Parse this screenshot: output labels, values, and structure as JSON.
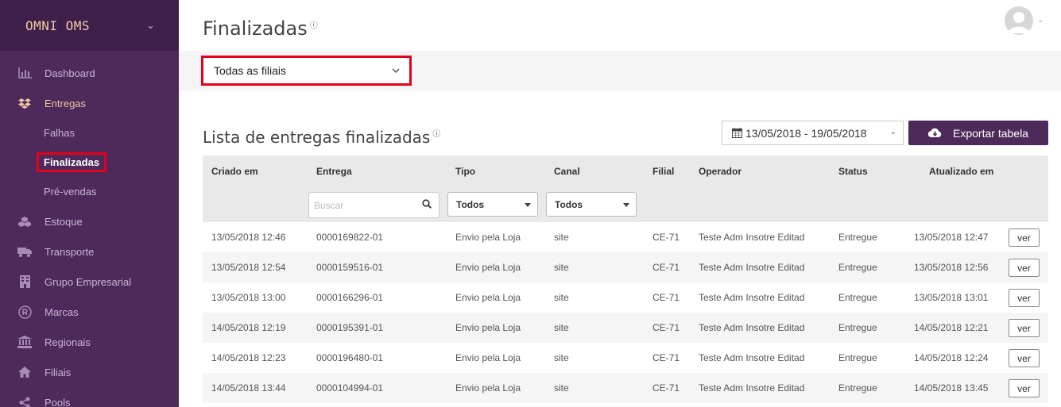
{
  "sidebar": {
    "brand": "OMNI OMS",
    "items": [
      {
        "label": "Dashboard",
        "icon": "bar-chart-icon"
      },
      {
        "label": "Entregas",
        "icon": "dropbox-icon"
      },
      {
        "label": "Falhas"
      },
      {
        "label": "Finalizadas"
      },
      {
        "label": "Pré-vendas"
      },
      {
        "label": "Estoque",
        "icon": "cubes-icon"
      },
      {
        "label": "Transporte",
        "icon": "truck-icon"
      },
      {
        "label": "Grupo Empresarial",
        "icon": "building-icon"
      },
      {
        "label": "Marcas",
        "icon": "registered-icon"
      },
      {
        "label": "Regionais",
        "icon": "bank-icon"
      },
      {
        "label": "Filiais",
        "icon": "home-icon"
      },
      {
        "label": "Pools",
        "icon": "share-icon"
      }
    ]
  },
  "header": {
    "title": "Finalizadas"
  },
  "filter": {
    "filial": "Todas as filiais"
  },
  "section": {
    "title": "Lista de entregas finalizadas",
    "date_range": "13/05/2018 - 19/05/2018",
    "export_label": "Exportar tabela"
  },
  "table": {
    "headers": [
      "Criado em",
      "Entrega",
      "Tipo",
      "Canal",
      "Filial",
      "Operador",
      "Status",
      "Atualizado em"
    ],
    "search_placeholder": "Buscar",
    "tipo_filter": "Todos",
    "canal_filter": "Todos",
    "action_label": "ver",
    "rows": [
      [
        "13/05/2018 12:46",
        "0000169822-01",
        "Envio pela Loja",
        "site",
        "CE-71",
        "Teste Adm Insotre Editad",
        "Entregue",
        "13/05/2018 12:47"
      ],
      [
        "13/05/2018 12:54",
        "0000159516-01",
        "Envio pela Loja",
        "site",
        "CE-71",
        "Teste Adm Insotre Editad",
        "Entregue",
        "13/05/2018 12:56"
      ],
      [
        "13/05/2018 13:00",
        "0000166296-01",
        "Envio pela Loja",
        "site",
        "CE-71",
        "Teste Adm Insotre Editad",
        "Entregue",
        "13/05/2018 13:01"
      ],
      [
        "14/05/2018 12:19",
        "0000195391-01",
        "Envio pela Loja",
        "site",
        "CE-71",
        "Teste Adm Insotre Editad",
        "Entregue",
        "14/05/2018 12:21"
      ],
      [
        "14/05/2018 12:23",
        "0000196480-01",
        "Envio pela Loja",
        "site",
        "CE-71",
        "Teste Adm Insotre Editad",
        "Entregue",
        "14/05/2018 12:24"
      ],
      [
        "14/05/2018 13:44",
        "0000104994-01",
        "Envio pela Loja",
        "site",
        "CE-71",
        "Teste Adm Insotre Editad",
        "Entregue",
        "14/05/2018 13:45"
      ]
    ]
  },
  "colors": {
    "sidebar_bg": "#4e2a5a",
    "brand_bg": "#3e1f4a",
    "accent": "#f2c3a6",
    "highlight": "#e3001b"
  }
}
